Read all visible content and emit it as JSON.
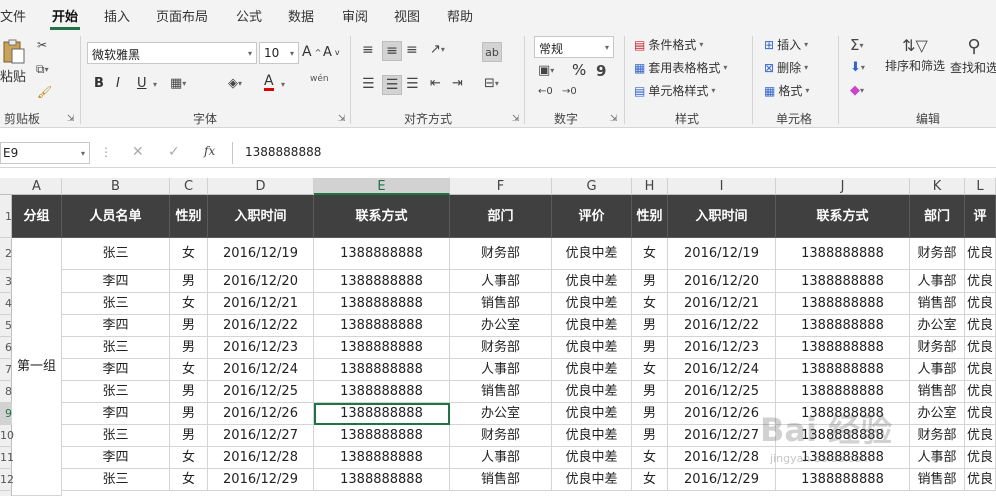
{
  "tabs": [
    "文件",
    "开始",
    "插入",
    "页面布局",
    "公式",
    "数据",
    "审阅",
    "视图",
    "帮助"
  ],
  "ribbon": {
    "clipboard": {
      "paste": "粘贴",
      "label": "剪贴板"
    },
    "font": {
      "name": "微软雅黑",
      "size": "10",
      "bold": "B",
      "italic": "I",
      "underline": "U",
      "font_color_glyph": "A",
      "phonetic": "wén",
      "label": "字体"
    },
    "align": {
      "label": "对齐方式"
    },
    "number": {
      "format": "常规",
      "percent": "%",
      "label": "数字"
    },
    "styles": {
      "conditional": "条件格式",
      "table": "套用表格格式",
      "cell_styles": "单元格样式",
      "label": "样式"
    },
    "cells": {
      "insert": "插入",
      "delete": "删除",
      "format": "格式",
      "label": "单元格"
    },
    "editing": {
      "sort_filter": "排序和筛选",
      "find": "查找和选",
      "label": "编辑"
    }
  },
  "formula_bar": {
    "name_box": "E9",
    "fx": "fx",
    "value": "1388888888"
  },
  "columns": [
    "A",
    "B",
    "C",
    "D",
    "E",
    "F",
    "G",
    "H",
    "I",
    "J",
    "K",
    "L"
  ],
  "header_row": [
    "分组",
    "人员名单",
    "性别",
    "入职时间",
    "联系方式",
    "部门",
    "评价",
    "性别",
    "入职时间",
    "联系方式",
    "部门",
    "评"
  ],
  "row_numbers": [
    "1",
    "2",
    "3",
    "4",
    "5",
    "6",
    "7",
    "8",
    "9",
    "10",
    "11",
    "12"
  ],
  "group_label": "第一组",
  "rows": [
    [
      "张三",
      "女",
      "2016/12/19",
      "1388888888",
      "财务部",
      "优良中差",
      "女",
      "2016/12/19",
      "1388888888",
      "财务部",
      "优良"
    ],
    [
      "李四",
      "男",
      "2016/12/20",
      "1388888888",
      "人事部",
      "优良中差",
      "男",
      "2016/12/20",
      "1388888888",
      "人事部",
      "优良"
    ],
    [
      "张三",
      "女",
      "2016/12/21",
      "1388888888",
      "销售部",
      "优良中差",
      "女",
      "2016/12/21",
      "1388888888",
      "销售部",
      "优良"
    ],
    [
      "李四",
      "男",
      "2016/12/22",
      "1388888888",
      "办公室",
      "优良中差",
      "男",
      "2016/12/22",
      "1388888888",
      "办公室",
      "优良"
    ],
    [
      "张三",
      "男",
      "2016/12/23",
      "1388888888",
      "财务部",
      "优良中差",
      "男",
      "2016/12/23",
      "1388888888",
      "财务部",
      "优良"
    ],
    [
      "李四",
      "女",
      "2016/12/24",
      "1388888888",
      "人事部",
      "优良中差",
      "女",
      "2016/12/24",
      "1388888888",
      "人事部",
      "优良"
    ],
    [
      "张三",
      "男",
      "2016/12/25",
      "1388888888",
      "销售部",
      "优良中差",
      "男",
      "2016/12/25",
      "1388888888",
      "销售部",
      "优良"
    ],
    [
      "李四",
      "男",
      "2016/12/26",
      "1388888888",
      "办公室",
      "优良中差",
      "男",
      "2016/12/26",
      "1388888888",
      "办公室",
      "优良"
    ],
    [
      "张三",
      "男",
      "2016/12/27",
      "1388888888",
      "财务部",
      "优良中差",
      "男",
      "2016/12/27",
      "1388888888",
      "财务部",
      "优良"
    ],
    [
      "李四",
      "女",
      "2016/12/28",
      "1388888888",
      "人事部",
      "优良中差",
      "女",
      "2016/12/28",
      "1388888888",
      "人事部",
      "优良"
    ],
    [
      "张三",
      "女",
      "2016/12/29",
      "1388888888",
      "销售部",
      "优良中差",
      "女",
      "2016/12/29",
      "1388888888",
      "销售部",
      "优良"
    ]
  ],
  "watermark": "Bai 经验",
  "watermark_sub": "jingyan.baidu.com",
  "colors": {
    "accent": "#217346",
    "header_fill": "#404040"
  }
}
